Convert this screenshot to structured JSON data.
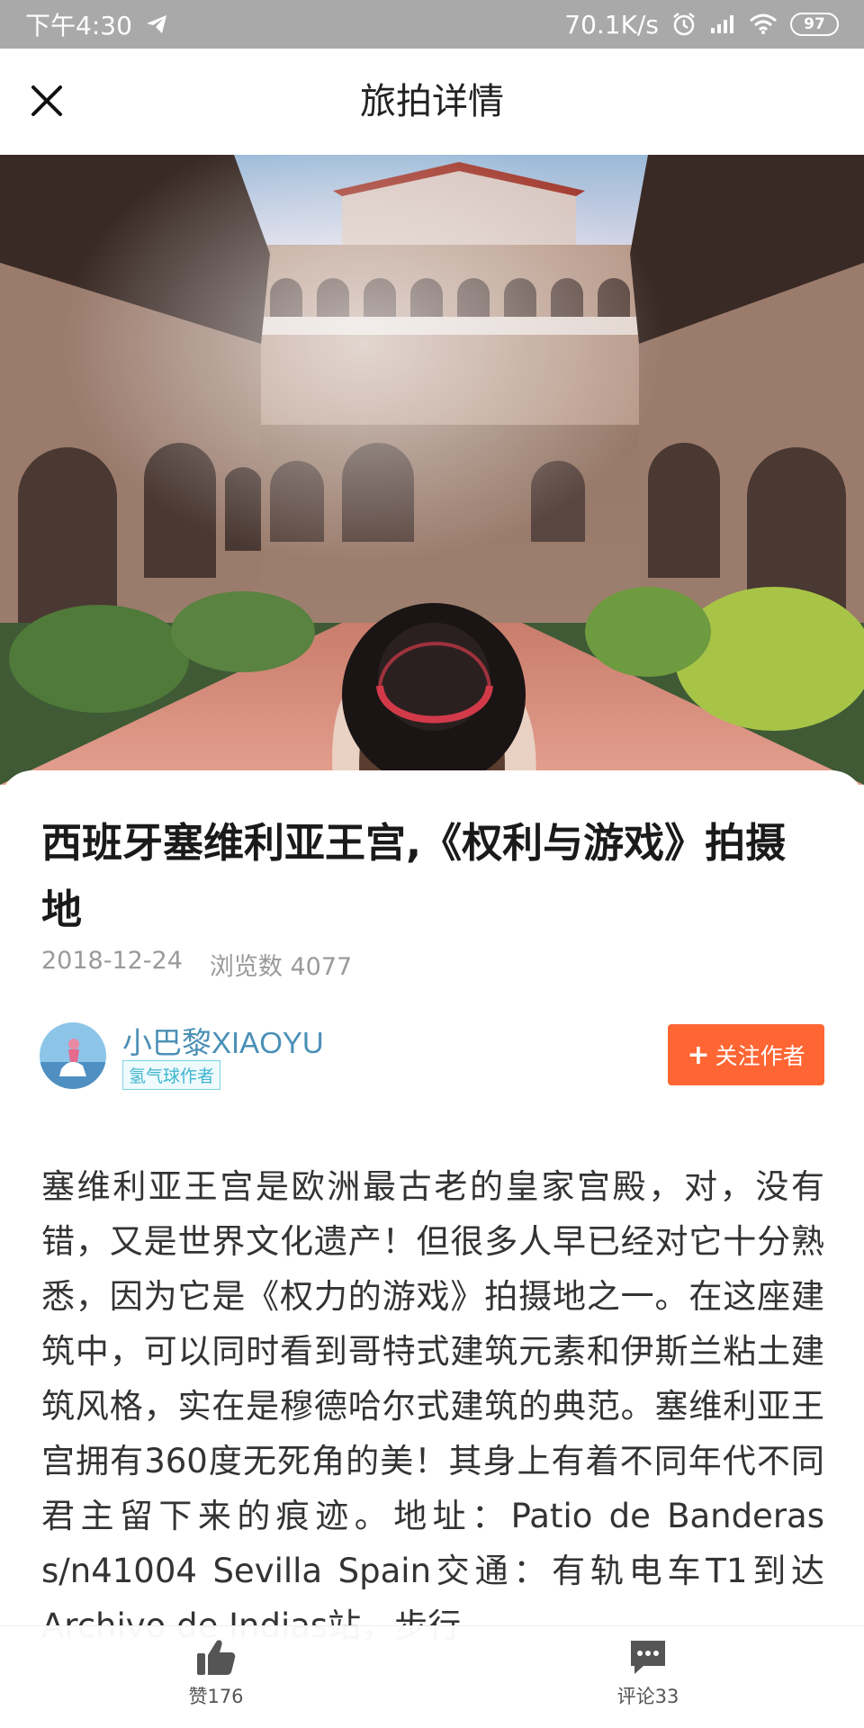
{
  "status_bar": {
    "time": "下午4:30",
    "network_speed": "70.1K/s",
    "battery": "97",
    "icons": [
      "telegram-icon",
      "alarm-icon",
      "signal-icon",
      "wifi-icon",
      "battery-icon"
    ]
  },
  "header": {
    "title": "旅拍详情",
    "close_icon": "close-icon"
  },
  "article": {
    "title": "西班牙塞维利亚王宫,《权利与游戏》拍摄地",
    "date": "2018-12-24",
    "views": "浏览数 4077",
    "body": "塞维利亚王宫是欧洲最古老的皇家宫殿，对，没有错，又是世界文化遗产！但很多人早已经对它十分熟悉，因为它是《权力的游戏》拍摄地之一。在这座建筑中，可以同时看到哥特式建筑元素和伊斯兰粘土建筑风格，实在是穆德哈尔式建筑的典范。塞维利亚王宫拥有360度无死角的美！其身上有着不同年代不同君主留下来的痕迹。地址：Patio de Banderas s/n41004 Sevilla Spain交通：有轨电车T1到达Archivo de Indias站，步行"
  },
  "author": {
    "name": "小巴黎XIAOYU",
    "badge": "氢气球作者",
    "follow_label": "关注作者",
    "follow_plus": "+"
  },
  "bottom_bar": {
    "like_label": "赞176",
    "comment_label": "评论33"
  },
  "colors": {
    "accent": "#ff6633",
    "author_name": "#4a8fb6",
    "badge": "#3fb6d0",
    "status_bar_bg": "#a9a9a9"
  }
}
